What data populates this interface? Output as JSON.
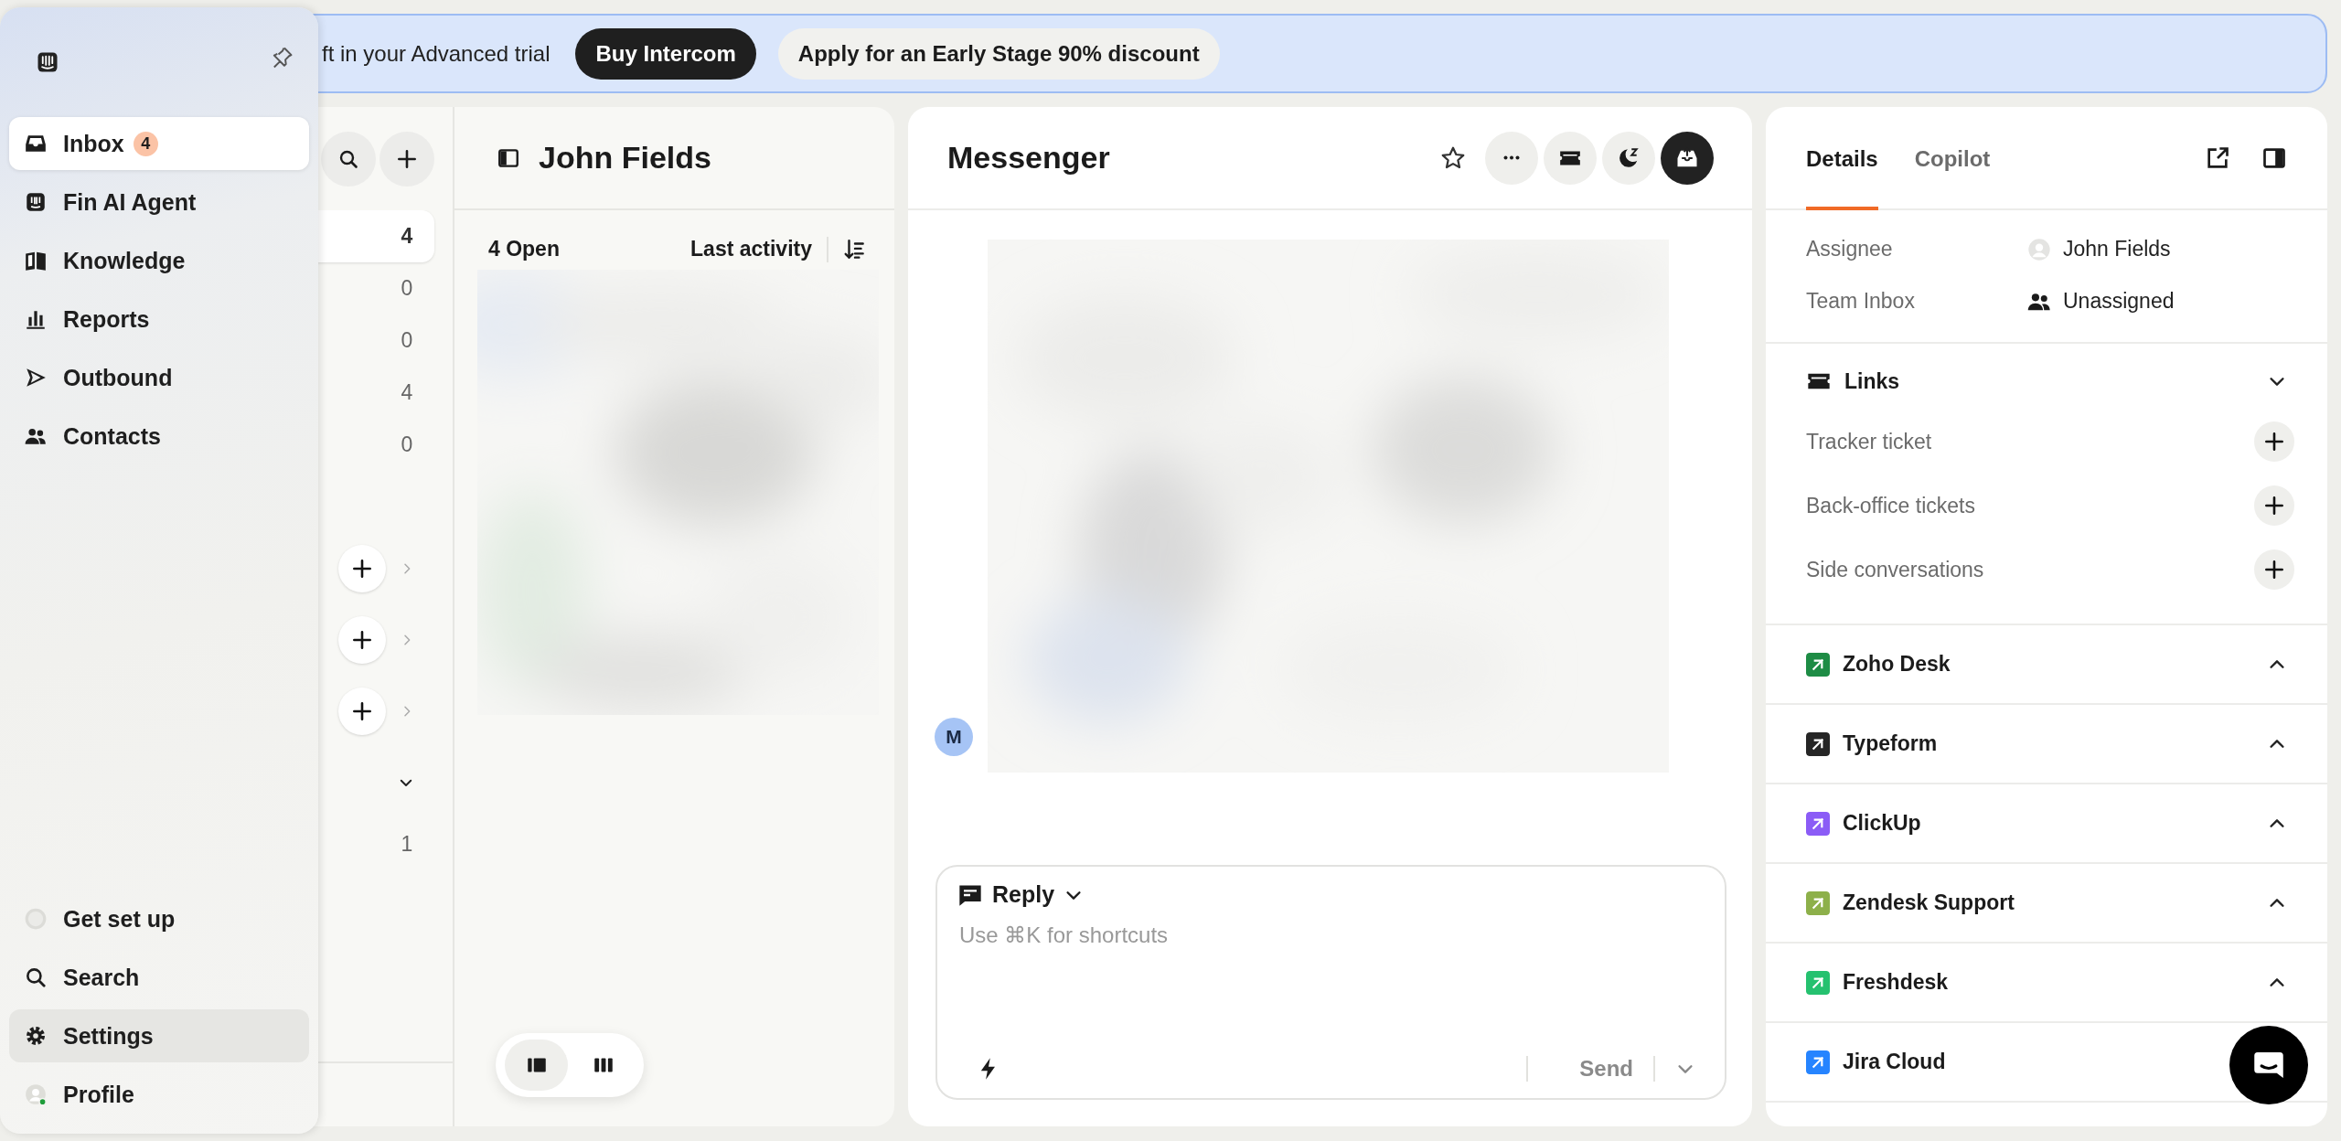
{
  "banner": {
    "text": "ft in your Advanced trial",
    "buttons": [
      {
        "label": "Buy Intercom",
        "kind": "primary"
      },
      {
        "label": "Apply for an Early Stage 90% discount",
        "kind": "secondary"
      }
    ]
  },
  "nav": {
    "items": [
      {
        "label": "Inbox",
        "badge": "4",
        "selected": true,
        "hovered": false
      },
      {
        "label": "Fin AI Agent",
        "selected": false,
        "hovered": false
      },
      {
        "label": "Knowledge",
        "selected": false,
        "hovered": false
      },
      {
        "label": "Reports",
        "selected": false,
        "hovered": false
      },
      {
        "label": "Outbound",
        "selected": false,
        "hovered": false
      },
      {
        "label": "Contacts",
        "selected": false,
        "hovered": false
      }
    ],
    "bottom_items": [
      {
        "label": "Get set up",
        "selected": false,
        "hovered": false
      },
      {
        "label": "Search",
        "selected": false,
        "hovered": false
      },
      {
        "label": "Settings",
        "selected": false,
        "hovered": true
      },
      {
        "label": "Profile",
        "selected": false,
        "hovered": false
      }
    ]
  },
  "inbox_list": {
    "rows": [
      {
        "kind": "count",
        "count": "4",
        "selected": true
      },
      {
        "kind": "count",
        "count": "0",
        "selected": false
      },
      {
        "kind": "count",
        "count": "0",
        "selected": false
      },
      {
        "kind": "count",
        "count": "4",
        "selected": false
      },
      {
        "kind": "count",
        "count": "0",
        "selected": false
      },
      {
        "kind": "add",
        "selected": false
      },
      {
        "kind": "add",
        "selected": false
      },
      {
        "kind": "add",
        "selected": false
      },
      {
        "kind": "collapse",
        "selected": false
      },
      {
        "kind": "count",
        "count": "1",
        "selected": false
      }
    ]
  },
  "conversations": {
    "title": "John Fields",
    "open_count": "4 Open",
    "sort": "Last activity",
    "view_toggle": [
      {
        "selected": true
      },
      {
        "selected": false
      }
    ]
  },
  "messenger": {
    "title": "Messenger",
    "avatar": "M",
    "composer": {
      "mode": "Reply",
      "placeholder": "Use ⌘K for shortcuts",
      "send": "Send"
    }
  },
  "details": {
    "tabs": [
      {
        "label": "Details",
        "selected": true
      },
      {
        "label": "Copilot",
        "selected": false
      }
    ],
    "attributes": [
      {
        "label": "Assignee",
        "value": "John Fields"
      },
      {
        "label": "Team Inbox",
        "value": "Unassigned"
      }
    ],
    "links": {
      "title": "Links",
      "expanded": true,
      "items": [
        "Tracker ticket",
        "Back-office tickets",
        "Side conversations"
      ]
    },
    "apps": [
      {
        "name": "Zoho Desk",
        "color": "#1e8c45",
        "expanded": false
      },
      {
        "name": "Typeform",
        "color": "#262626",
        "expanded": false
      },
      {
        "name": "ClickUp",
        "color": "#8b5cf6",
        "expanded": false
      },
      {
        "name": "Zendesk Support",
        "color": "#8db04a",
        "expanded": false
      },
      {
        "name": "Freshdesk",
        "color": "#25c16f",
        "expanded": false
      },
      {
        "name": "Jira Cloud",
        "color": "#2684ff"
      }
    ]
  }
}
